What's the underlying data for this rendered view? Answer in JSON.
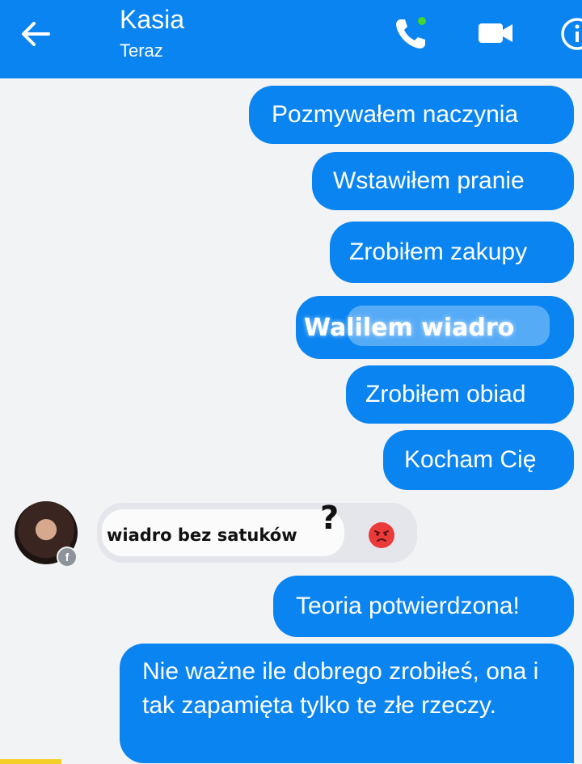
{
  "header": {
    "contact_name": "Kasia",
    "status": "Teraz",
    "background": "#0a84f0",
    "icons": [
      "back-arrow-icon",
      "phone-icon",
      "video-camera-icon",
      "info-icon"
    ],
    "online_dot_color": "#44d62c"
  },
  "messages": {
    "sent": [
      "Pozmywałem naczynia",
      "Wstawiłem pranie",
      "Zrobiłem zakupy",
      "Walilem wiadro",
      "Zrobiłem obiad",
      "Kocham Cię",
      "Teoria potwierdzona!",
      "Nie ważne ile dobrego zrobiłeś, ona i tak zapamięta tylko te złe rzeczy."
    ],
    "received": {
      "text": "wiadro bez satuków",
      "question_mark": "?",
      "reaction_icon": "angry-face-icon"
    }
  },
  "colors": {
    "sent_bubble": "#0a84f0",
    "received_bubble": "#e4e6eb",
    "background": "#f2f3f5"
  }
}
